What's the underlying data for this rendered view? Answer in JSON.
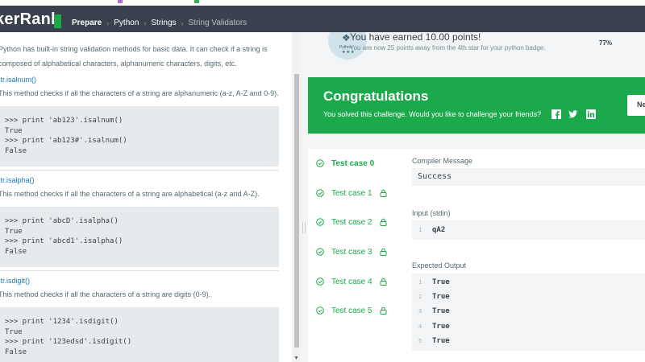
{
  "nav": {
    "logo": "kerRank",
    "crumbs": [
      "Prepare",
      "Python",
      "Strings",
      "String Validators"
    ]
  },
  "left": {
    "intro1": "Python has built-in string validation methods for basic data. It can check if a string is",
    "intro2": "composed of alphabetical characters, alphanumeric characters, digits, etc.",
    "sections": [
      {
        "heading": "str.isalnum()",
        "desc": "This method checks if all the characters of a string are alphanumeric (a-z, A-Z and 0-9).",
        "code": [
          ">>> print 'ab123'.isalnum()",
          "True",
          ">>> print 'ab123#'.isalnum()",
          "False"
        ]
      },
      {
        "heading": "str.isalpha()",
        "desc": "This method checks if all the characters of a string are alphabetical (a-z and A-Z).",
        "code": [
          ">>> print 'abcD'.isalpha()",
          "True",
          ">>> print 'abcd1'.isalpha()",
          "False"
        ]
      },
      {
        "heading": "str.isdigit()",
        "desc": "This method checks if all the characters of a string are digits (0-9).",
        "code": [
          ">>> print '1234'.isdigit()",
          "True",
          ">>> print '123edsd'.isdigit()",
          "False"
        ]
      }
    ]
  },
  "badge": {
    "label": "Python",
    "earned": "You have earned 10.00 points!",
    "sub": "You are now 25 points away from the 4th star for your python badge.",
    "percent": "77%"
  },
  "congrats": {
    "title": "Congratulations",
    "subtitle": "You solved this challenge. Would you like to challenge your friends?",
    "next_label": "Ne"
  },
  "tests": [
    {
      "label": "Test case 0",
      "locked": false
    },
    {
      "label": "Test case 1",
      "locked": true
    },
    {
      "label": "Test case 2",
      "locked": true
    },
    {
      "label": "Test case 3",
      "locked": true
    },
    {
      "label": "Test case 4",
      "locked": true
    },
    {
      "label": "Test case 5",
      "locked": true
    }
  ],
  "result": {
    "compiler_label": "Compiler Message",
    "compiler_value": "Success",
    "input_label": "Input (stdin)",
    "input_lines": [
      {
        "n": "1",
        "v": "qA2"
      }
    ],
    "expected_label": "Expected Output",
    "expected_lines": [
      {
        "n": "1",
        "v": "True"
      },
      {
        "n": "2",
        "v": "True"
      },
      {
        "n": "3",
        "v": "True"
      },
      {
        "n": "4",
        "v": "True"
      },
      {
        "n": "5",
        "v": "True"
      }
    ]
  },
  "colors": {
    "green": "#1ba94c",
    "nav": "#39424e",
    "link": "#1c79c0"
  }
}
